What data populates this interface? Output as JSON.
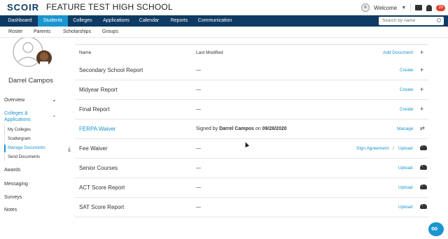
{
  "header": {
    "logo": "SCOIR",
    "school": "FEATURE TEST HIGH SCHOOL",
    "welcome": "Welcome",
    "notification_count": "20"
  },
  "nav": {
    "tabs": [
      "Dashboard",
      "Students",
      "Colleges",
      "Applications",
      "Calendar",
      "Reports",
      "Communication"
    ],
    "active": "Students",
    "search_placeholder": "Search by name"
  },
  "subnav": {
    "items": [
      "Roster",
      "Parents",
      "Scholarships",
      "Groups"
    ]
  },
  "sidebar": {
    "student_name": "Darrel Campos",
    "overview": "Overview",
    "colleges_applications": "Colleges & Applications",
    "sub_items": [
      "My Colleges",
      "Scattergram",
      "Manage Documents",
      "Send Documents"
    ],
    "active_sub": "Manage Documents",
    "awards": "Awards",
    "messaging": "Messaging",
    "surveys": "Surveys",
    "notes": "Notes"
  },
  "documents": {
    "headers": {
      "name": "Name",
      "last_modified": "Last Modified",
      "add": "Add Document"
    },
    "rows": [
      {
        "name": "Secondary School Report",
        "modified": "—",
        "action": "Create"
      },
      {
        "name": "Midyear Report",
        "modified": "—",
        "action": "Create"
      },
      {
        "name": "Final Report",
        "modified": "—",
        "action": "Create"
      },
      {
        "name": "FERPA Waiver",
        "modified_prefix": "Signed by",
        "modified_by": "Darrel Campos",
        "modified_on": "on",
        "modified_date": "09/28/2020",
        "action": "Manage"
      },
      {
        "name": "Fee Waiver",
        "modified": "—",
        "action": "Sign Agreement",
        "action2": "Upload"
      },
      {
        "name": "Senior Courses",
        "modified": "—",
        "action": "Upload"
      },
      {
        "name": "ACT Score Report",
        "modified": "—",
        "action": "Upload"
      },
      {
        "name": "SAT Score Report",
        "modified": "—",
        "action": "Upload"
      }
    ]
  },
  "colors": {
    "navy": "#0e3a63",
    "accent": "#1a95cf"
  },
  "icons": [
    "plus-icon",
    "swap-icon",
    "cloud-upload-icon",
    "download-icon",
    "chat-icon",
    "bell-icon",
    "help-chat-icon"
  ]
}
